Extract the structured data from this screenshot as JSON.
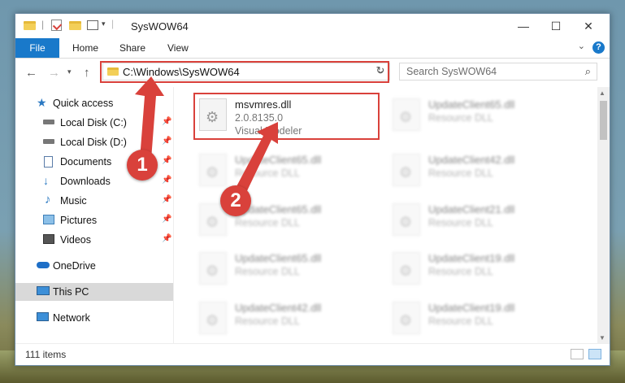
{
  "window": {
    "title": "SysWOW64",
    "minimize": "—",
    "maximize": "☐",
    "close": "✕"
  },
  "ribbon": {
    "tabs": [
      "File",
      "Home",
      "Share",
      "View"
    ],
    "help": "?"
  },
  "address": {
    "path": "C:\\Windows\\SysWOW64",
    "search_placeholder": "Search SysWOW64"
  },
  "sidebar": {
    "items": [
      {
        "label": "Quick access",
        "icon": "star-icon"
      },
      {
        "label": "Local Disk (C:)",
        "icon": "drive-icon"
      },
      {
        "label": "Local Disk (D:)",
        "icon": "drive-icon"
      },
      {
        "label": "Documents",
        "icon": "documents-icon"
      },
      {
        "label": "Downloads",
        "icon": "downloads-icon"
      },
      {
        "label": "Music",
        "icon": "music-icon"
      },
      {
        "label": "Pictures",
        "icon": "pictures-icon"
      },
      {
        "label": "Videos",
        "icon": "videos-icon"
      },
      {
        "label": "OneDrive",
        "icon": "cloud-icon"
      },
      {
        "label": "This PC",
        "icon": "computer-icon"
      },
      {
        "label": "Network",
        "icon": "network-icon"
      }
    ]
  },
  "files": [
    {
      "name": "msvmres.dll",
      "line2": "2.0.8135.0",
      "line3": "Visual Modeler"
    },
    {
      "name": "UpdateClient65.dll",
      "line2": "Resource DLL"
    },
    {
      "name": "UpdateClient65.dll",
      "line2": "Resource DLL"
    },
    {
      "name": "UpdateClient42.dll",
      "line2": "Resource DLL"
    },
    {
      "name": "UpdateClient65.dll",
      "line2": "Resource DLL"
    },
    {
      "name": "UpdateClient21.dll",
      "line2": "Resource DLL"
    },
    {
      "name": "UpdateClient65.dll",
      "line2": "Resource DLL"
    },
    {
      "name": "UpdateClient19.dll",
      "line2": "Resource DLL"
    },
    {
      "name": "UpdateClient42.dll",
      "line2": "Resource DLL"
    },
    {
      "name": "UpdateClient19.dll",
      "line2": "Resource DLL"
    }
  ],
  "status": {
    "item_count": "111 items"
  },
  "annotations": {
    "step1": "1",
    "step2": "2",
    "color": "#d9413b"
  }
}
